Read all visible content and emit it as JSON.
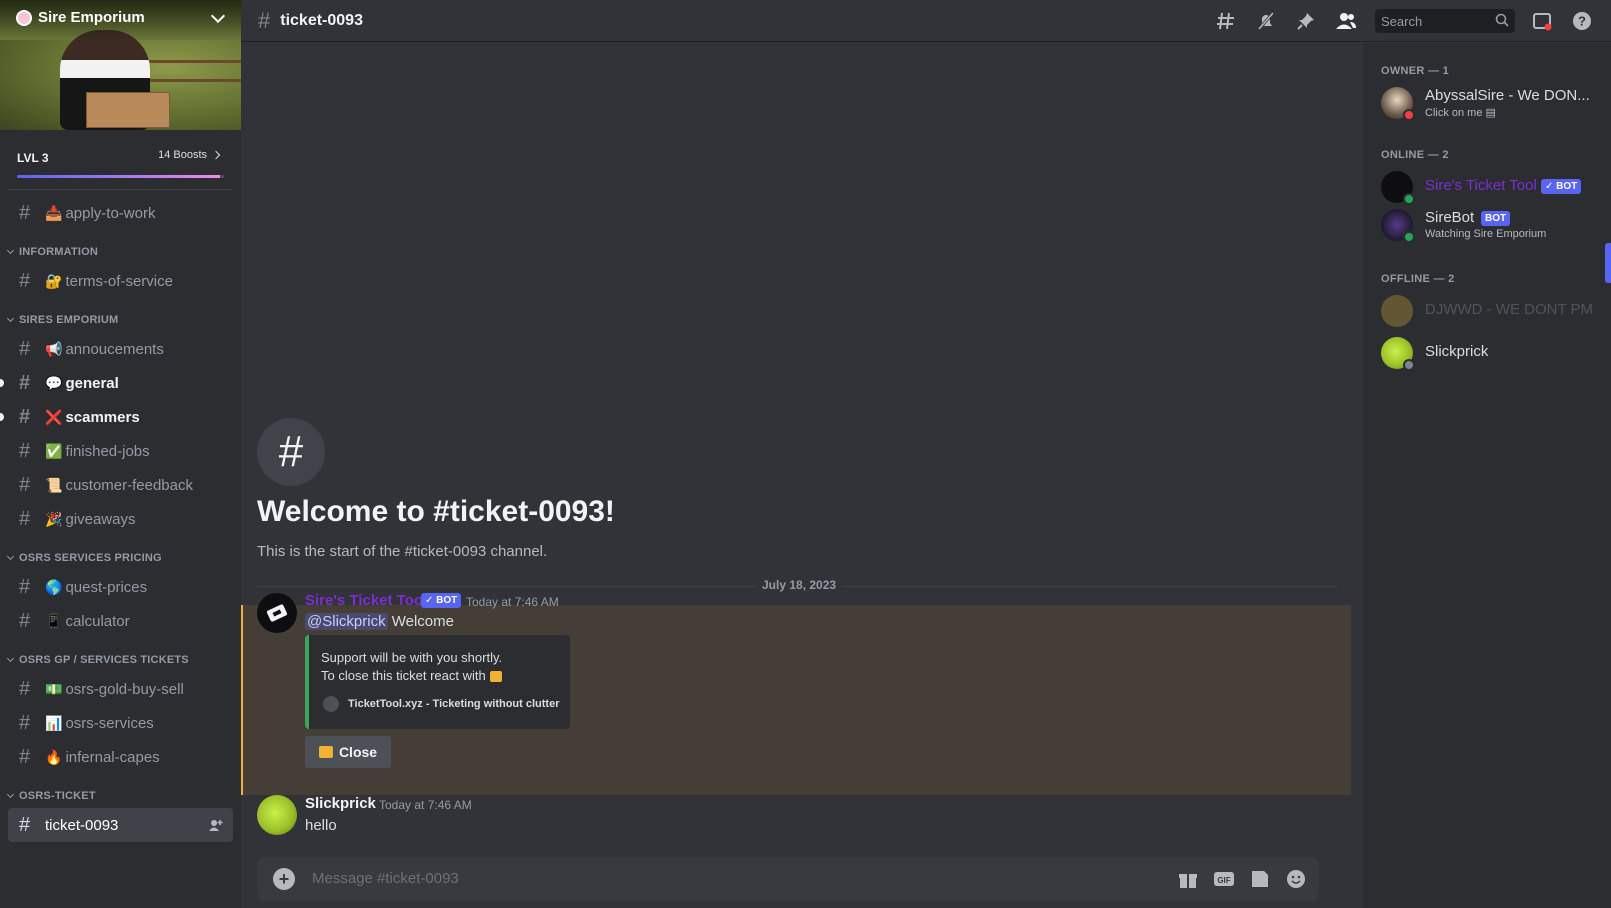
{
  "server": {
    "name": "Sire Emporium",
    "level": "LVL 3",
    "boosts": "14 Boosts",
    "boost_progress": 0.98
  },
  "sidebar": {
    "top_channels": [
      {
        "emoji": "📥",
        "name": "apply-to-work"
      }
    ],
    "categories": [
      {
        "name": "INFORMATION",
        "channels": [
          {
            "emoji": "🔐",
            "name": "terms-of-service",
            "unread": false
          }
        ]
      },
      {
        "name": "SIRES EMPORIUM",
        "channels": [
          {
            "emoji": "📢",
            "name": "annoucements",
            "unread": false
          },
          {
            "emoji": "💬",
            "name": "general",
            "unread": true
          },
          {
            "emoji": "❌",
            "name": "scammers",
            "unread": true
          },
          {
            "emoji": "✅",
            "name": "finished-jobs",
            "unread": false
          },
          {
            "emoji": "📜",
            "name": "customer-feedback",
            "unread": false
          },
          {
            "emoji": "🎉",
            "name": "giveaways",
            "unread": false
          }
        ]
      },
      {
        "name": "OSRS SERVICES PRICING",
        "channels": [
          {
            "emoji": "🌎",
            "name": "quest-prices",
            "unread": false
          },
          {
            "emoji": "📱",
            "name": "calculator",
            "unread": false
          }
        ]
      },
      {
        "name": "OSRS GP / SERVICES TICKETS",
        "channels": [
          {
            "emoji": "💵",
            "name": "osrs-gold-buy-sell",
            "unread": false
          },
          {
            "emoji": "📊",
            "name": "osrs-services",
            "unread": false
          },
          {
            "emoji": "🔥",
            "name": "infernal-capes",
            "unread": false
          }
        ]
      },
      {
        "name": "OSRS-TICKET",
        "channels": [
          {
            "emoji": "",
            "name": "ticket-0093",
            "unread": false,
            "active": true
          }
        ]
      }
    ]
  },
  "topbar": {
    "channel": "ticket-0093",
    "search_placeholder": "Search"
  },
  "chat": {
    "welcome_title": "Welcome to #ticket-0093!",
    "welcome_sub": "This is the start of the #ticket-0093 channel.",
    "date_divider": "July 18, 2023",
    "messages": [
      {
        "author": "Sire's Ticket Tool",
        "author_color": "#7b2fd0",
        "bot_tag": "✓ BOT",
        "time": "Today at 7:46 AM",
        "mention": "@Slickprick",
        "text": "Welcome",
        "embed_line1": "Support will be with you shortly.",
        "embed_line2": "To close this ticket react with",
        "embed_footer": "TicketTool.xyz - Ticketing without clutter",
        "button": "Close"
      },
      {
        "author": "Slickprick",
        "author_color": "#f2f3f5",
        "time": "Today at 7:46 AM",
        "text": "hello"
      }
    ],
    "composer_placeholder": "Message #ticket-0093"
  },
  "members": {
    "groups": [
      {
        "label": "OWNER — 1",
        "members": [
          {
            "name": "AbyssalSire - We DON...",
            "sub": "Click on me",
            "color": "#dbdee1",
            "status": "#f23f43"
          }
        ]
      },
      {
        "label": "ONLINE — 2",
        "members": [
          {
            "name": "Sire's Ticket Tool",
            "tag": "✓ BOT",
            "color": "#7b2fd0",
            "status": "#23a55a"
          },
          {
            "name": "SireBot",
            "tag": "BOT",
            "sub": "Watching Sire Emporium",
            "color": "#dbdee1",
            "status": "#23a55a"
          }
        ]
      },
      {
        "label": "OFFLINE — 2",
        "members": [
          {
            "name": "DJWWD - WE DONT PM",
            "color": "#949ba4",
            "status": ""
          },
          {
            "name": "Slickprick",
            "color": "#dbdee1",
            "status": "#80848e"
          }
        ]
      }
    ]
  }
}
